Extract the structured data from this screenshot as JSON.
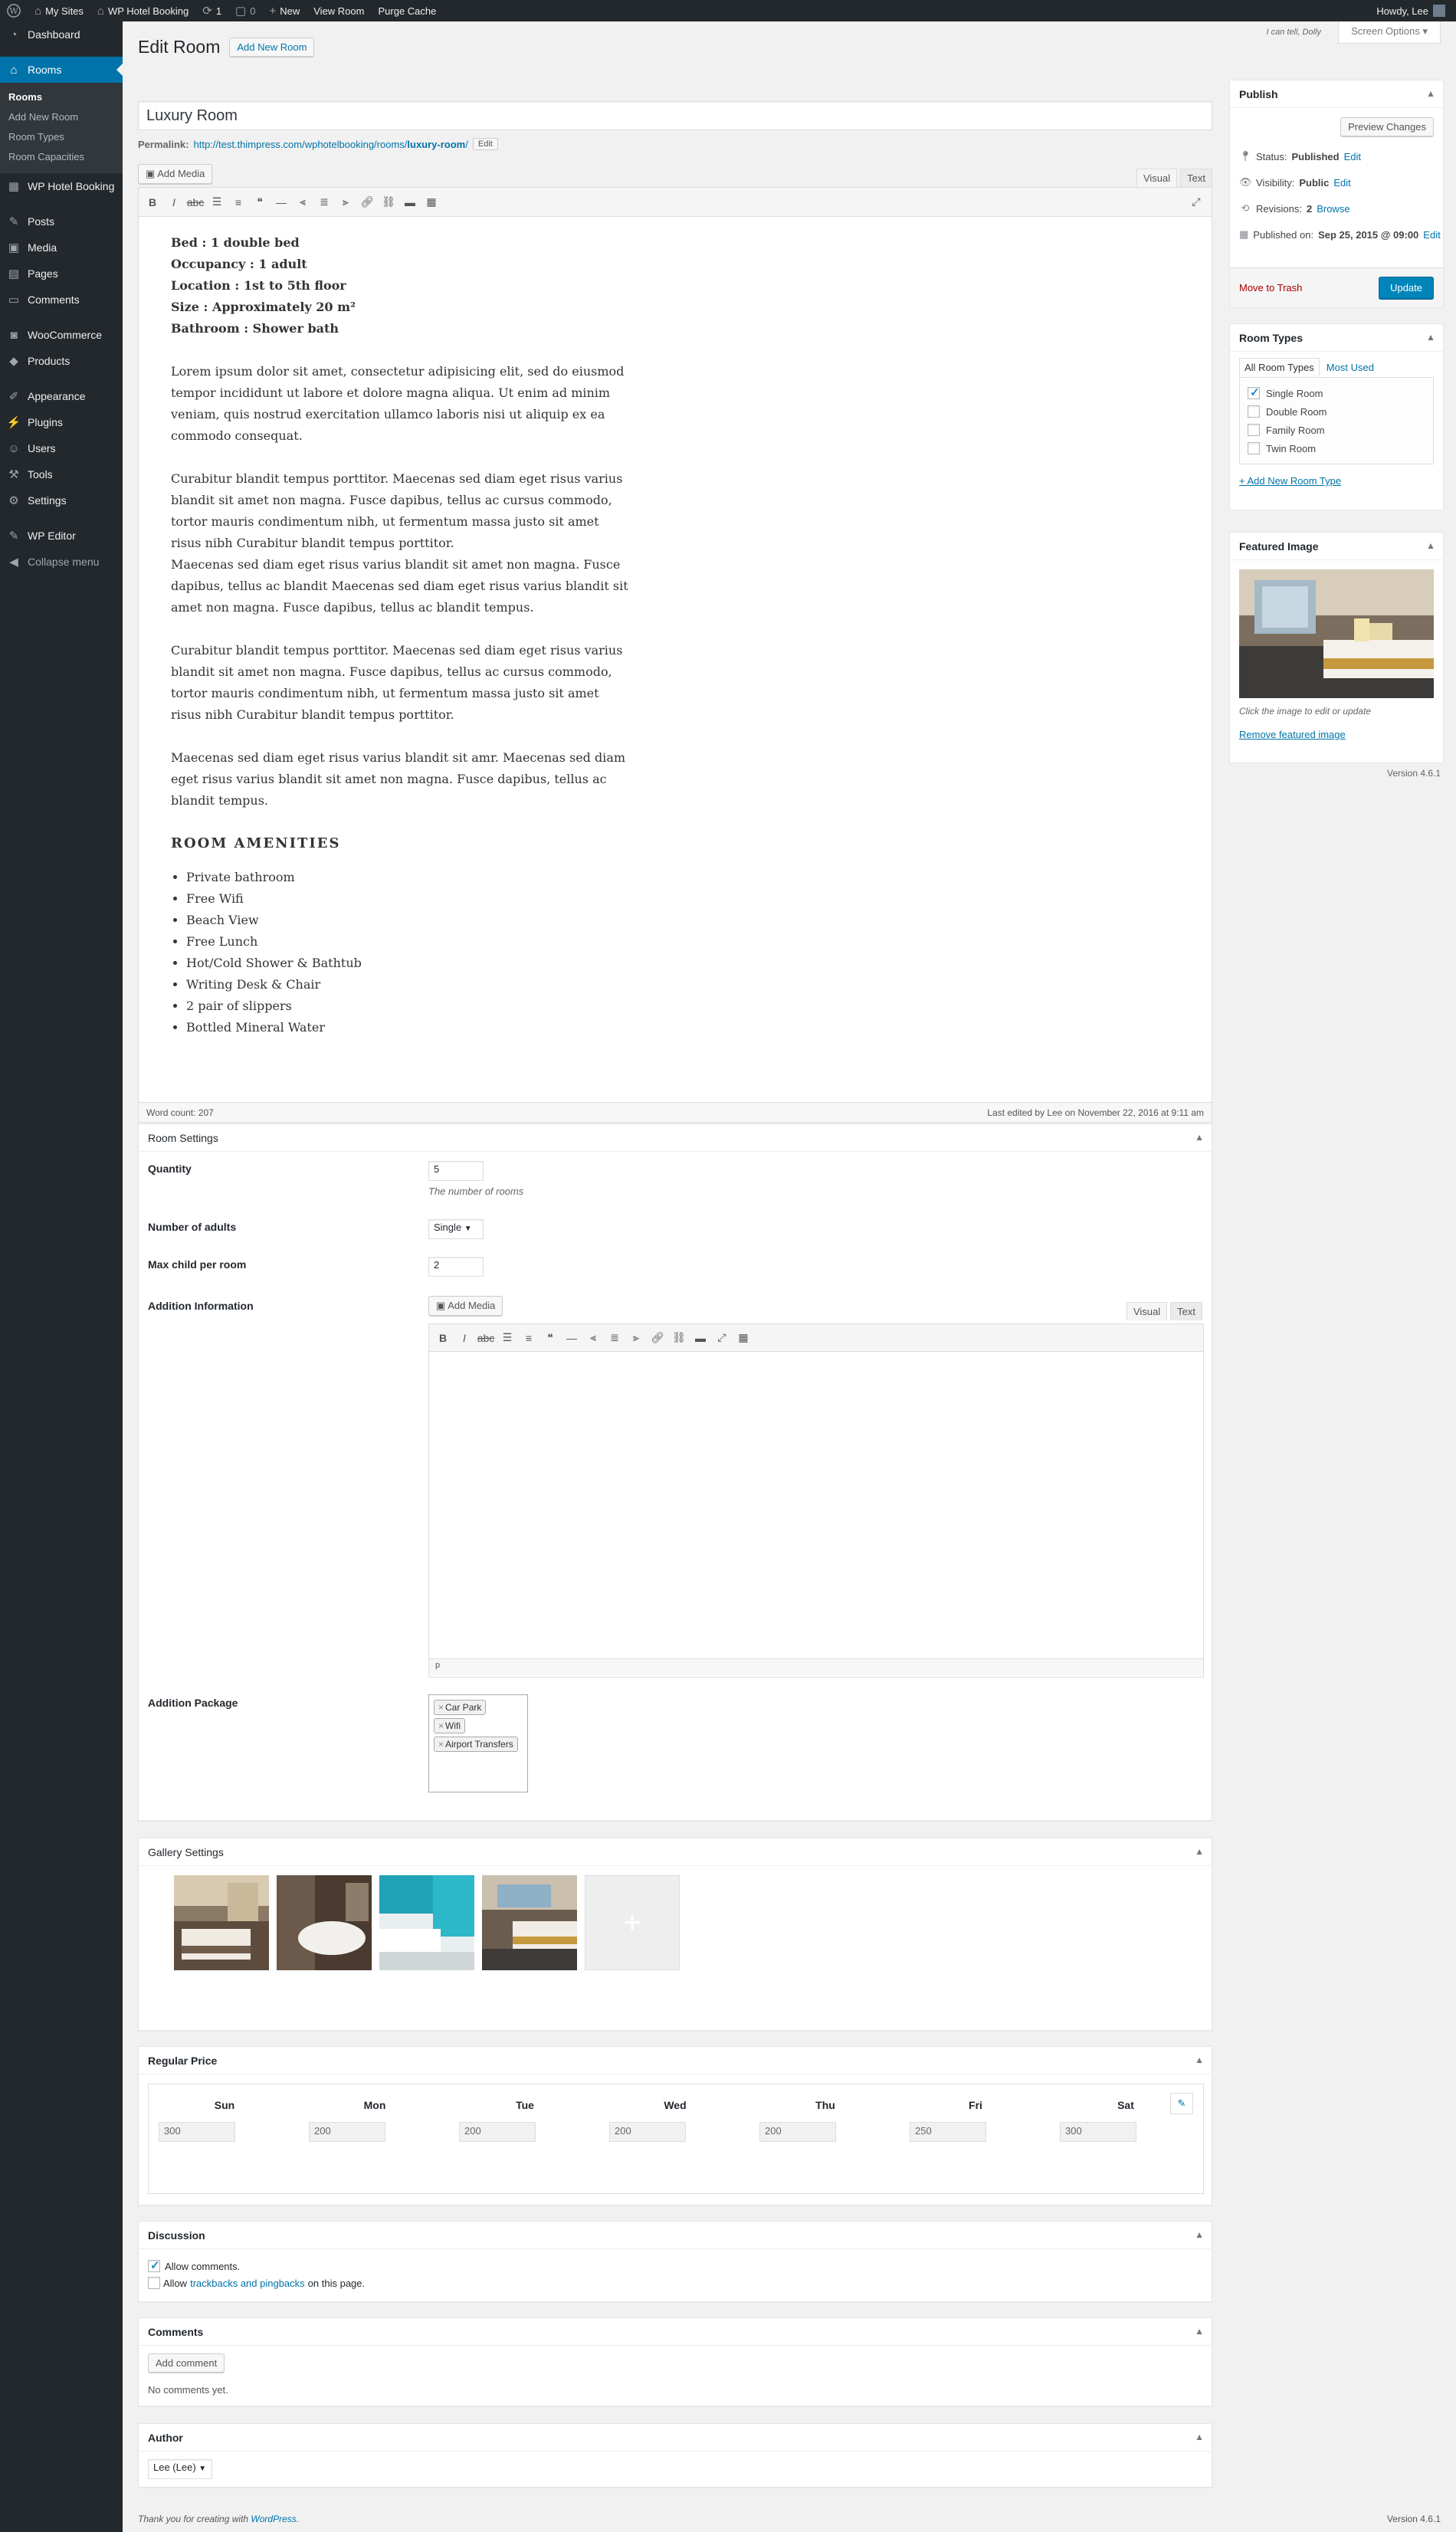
{
  "adminbar": {
    "my_sites": "My Sites",
    "site_name": "WP Hotel Booking",
    "updates": "1",
    "comments": "0",
    "new": "New",
    "view_room": "View Room",
    "purge_cache": "Purge Cache",
    "howdy": "Howdy, Lee"
  },
  "sidebar": {
    "items": [
      {
        "label": "Dashboard",
        "icon": "dashboard-icon"
      },
      {
        "label": "Rooms",
        "icon": "home-icon"
      },
      {
        "label": "WP Hotel Booking",
        "icon": "hotel-booking-icon"
      },
      {
        "label": "Posts",
        "icon": "pin-icon"
      },
      {
        "label": "Media",
        "icon": "media-icon"
      },
      {
        "label": "Pages",
        "icon": "page-icon"
      },
      {
        "label": "Comments",
        "icon": "comment-icon"
      },
      {
        "label": "WooCommerce",
        "icon": "woocommerce-icon"
      },
      {
        "label": "Products",
        "icon": "archive-icon"
      },
      {
        "label": "Appearance",
        "icon": "brush-icon"
      },
      {
        "label": "Plugins",
        "icon": "plugin-icon"
      },
      {
        "label": "Users",
        "icon": "users-icon"
      },
      {
        "label": "Tools",
        "icon": "wrench-icon"
      },
      {
        "label": "Settings",
        "icon": "settings-icon"
      },
      {
        "label": "WP Editor",
        "icon": "editor-icon"
      },
      {
        "label": "Collapse menu",
        "icon": "collapse-icon"
      }
    ],
    "submenu": [
      "Rooms",
      "Add New Room",
      "Room Types",
      "Room Capacities"
    ]
  },
  "header": {
    "title": "Edit Room",
    "add_new": "Add New Room",
    "dolly": "I can tell, Dolly",
    "screen_options": "Screen Options"
  },
  "post": {
    "title": "Luxury Room",
    "permalink_label": "Permalink:",
    "permalink_base": "http://test.thimpress.com/wphotelbooking/rooms/",
    "permalink_slug": "luxury-room",
    "permalink_end": "/",
    "edit_slug": "Edit"
  },
  "editor": {
    "add_media": "Add Media",
    "visual": "Visual",
    "text": "Text",
    "details": [
      "Bed : 1 double bed",
      "Occupancy : 1 adult",
      "Location : 1st to 5th floor",
      "Size : Approximately 20 m²",
      "Bathroom : Shower bath"
    ],
    "paragraphs": [
      "Lorem ipsum dolor sit amet, consectetur adipisicing elit, sed do eiusmod tempor incididunt ut labore et dolore magna aliqua. Ut enim ad minim veniam, quis nostrud exercitation ullamco laboris nisi ut aliquip ex ea commodo consequat.",
      "Curabitur blandit tempus porttitor. Maecenas sed diam eget risus varius blandit sit amet non magna. Fusce dapibus, tellus ac cursus commodo, tortor mauris condimentum nibh, ut fermentum massa justo sit amet risus nibh Curabitur blandit tempus porttitor.\nMaecenas sed diam eget risus varius blandit sit amet non magna. Fusce dapibus, tellus ac blandit Maecenas sed diam eget risus varius blandit sit amet non magna. Fusce dapibus, tellus ac blandit tempus.",
      "Curabitur blandit tempus porttitor. Maecenas sed diam eget risus varius blandit sit amet non magna. Fusce dapibus, tellus ac cursus commodo, tortor mauris condimentum nibh, ut fermentum massa justo sit amet risus nibh Curabitur blandit tempus porttitor.",
      "Maecenas sed diam eget risus varius blandit sit amr. Maecenas sed diam eget risus varius blandit sit amet non magna. Fusce dapibus, tellus ac blandit tempus."
    ],
    "amenities_title": "ROOM AMENITIES",
    "amenities": [
      "Private bathroom",
      "Free Wifi",
      "Beach View",
      "Free Lunch",
      "Hot/Cold Shower & Bathtub",
      "Writing Desk & Chair",
      "2 pair of slippers",
      "Bottled Mineral Water"
    ],
    "word_count": "Word count: 207",
    "last_edited": "Last edited by Lee on November 22, 2016 at 9:11 am"
  },
  "room_settings": {
    "title": "Room Settings",
    "quantity_label": "Quantity",
    "quantity_value": "5",
    "quantity_desc": "The number of rooms",
    "adults_label": "Number of adults",
    "adults_value": "Single",
    "max_child_label": "Max child per room",
    "max_child_value": "2",
    "addition_info_label": "Addition Information",
    "add_media": "Add Media",
    "visual": "Visual",
    "text": "Text",
    "path": "p",
    "addition_package_label": "Addition Package",
    "packages": [
      "Car Park",
      "Wifi",
      "Airport Transfers"
    ]
  },
  "gallery": {
    "title": "Gallery Settings",
    "add_icon": "+"
  },
  "price": {
    "title": "Regular Price",
    "days": [
      "Sun",
      "Mon",
      "Tue",
      "Wed",
      "Thu",
      "Fri",
      "Sat"
    ],
    "values": [
      "300",
      "200",
      "200",
      "200",
      "200",
      "250",
      "300"
    ]
  },
  "discussion": {
    "title": "Discussion",
    "allow_comments": "Allow comments.",
    "allow_prefix": "Allow",
    "trackbacks_link": "trackbacks and pingbacks",
    "allow_suffix": "on this page."
  },
  "comments_box": {
    "title": "Comments",
    "add_comment": "Add comment",
    "no_comments": "No comments yet."
  },
  "author": {
    "title": "Author",
    "value": "Lee (Lee)"
  },
  "publish": {
    "title": "Publish",
    "preview": "Preview Changes",
    "status_label": "Status:",
    "status_value": "Published",
    "visibility_label": "Visibility:",
    "visibility_value": "Public",
    "revisions_label": "Revisions:",
    "revisions_value": "2",
    "browse": "Browse",
    "published_label": "Published on:",
    "published_value": "Sep 25, 2015 @ 09:00",
    "edit": "Edit",
    "trash": "Move to Trash",
    "update": "Update"
  },
  "room_types": {
    "title": "Room Types",
    "tab_all": "All Room Types",
    "tab_most": "Most Used",
    "items": [
      {
        "label": "Single Room",
        "checked": true
      },
      {
        "label": "Double Room",
        "checked": false
      },
      {
        "label": "Family Room",
        "checked": false
      },
      {
        "label": "Twin Room",
        "checked": false
      }
    ],
    "add_new": "+ Add New Room Type"
  },
  "featured": {
    "title": "Featured Image",
    "hint": "Click the image to edit or update",
    "remove": "Remove featured image"
  },
  "footer": {
    "thanks_prefix": "Thank you for creating with",
    "thanks_link": "WordPress",
    "thanks_suffix": ".",
    "version": "Version 4.6.1"
  },
  "colors": {
    "accent": "#0073aa",
    "sidebar_bg": "#23282d",
    "update_button": "#0085ba"
  }
}
